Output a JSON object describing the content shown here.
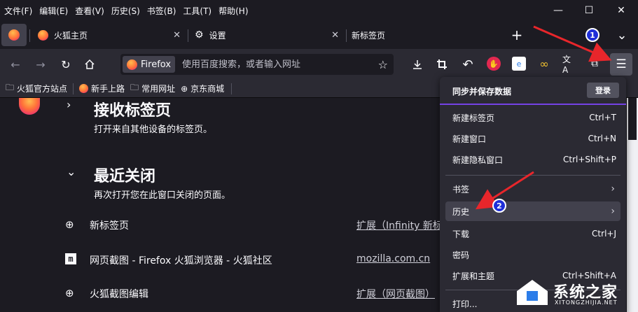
{
  "menubar": {
    "items": [
      "文件(F)",
      "编辑(E)",
      "查看(V)",
      "历史(S)",
      "书签(B)",
      "工具(T)",
      "帮助(H)"
    ]
  },
  "window_controls": {
    "minimize": "—",
    "maximize": "☐",
    "close": "✕"
  },
  "tabs": [
    {
      "label": "火狐主页",
      "icon": "firefox-icon"
    },
    {
      "label": "设置",
      "icon": "gear-icon"
    },
    {
      "label": "新标签页",
      "icon": ""
    }
  ],
  "tabstrip": {
    "new_tab": "+",
    "list_all": "⌄"
  },
  "urlbar": {
    "engine_label": "Firefox",
    "placeholder": "使用百度搜索，或者输入网址"
  },
  "bookmarks": [
    {
      "label": "火狐官方站点",
      "icon": "folder-icon"
    },
    {
      "label": "新手上路",
      "icon": "firefox-icon"
    },
    {
      "label": "常用网址",
      "icon": "folder-icon"
    },
    {
      "label": "京东商城",
      "icon": "globe-icon"
    }
  ],
  "content": {
    "synced_tabs": {
      "title": "接收标签页",
      "subtitle": "打开来自其他设备的标签页。"
    },
    "recently_closed": {
      "title": "最近关闭",
      "subtitle": "再次打开您在此窗口关闭的页面。",
      "rows": [
        {
          "icon": "globe-icon",
          "title": "新标签页",
          "url": "扩展（Infinity 新标"
        },
        {
          "icon": "mozilla-m-icon",
          "title": "网页截图 - Firefox 火狐浏览器 - 火狐社区",
          "url": "mozilla.com.cn"
        },
        {
          "icon": "globe-icon",
          "title": "火狐截图编辑",
          "url": "扩展（网页截图）"
        }
      ]
    }
  },
  "app_menu": {
    "header": "同步并保存数据",
    "signin": "登录",
    "items": [
      {
        "label": "新建标签页",
        "shortcut": "Ctrl+T"
      },
      {
        "label": "新建窗口",
        "shortcut": "Ctrl+N"
      },
      {
        "label": "新建隐私窗口",
        "shortcut": "Ctrl+Shift+P"
      },
      {
        "label": "书签",
        "shortcut": ""
      },
      {
        "label": "历史",
        "shortcut": ""
      },
      {
        "label": "下载",
        "shortcut": "Ctrl+J"
      },
      {
        "label": "密码",
        "shortcut": ""
      },
      {
        "label": "扩展和主题",
        "shortcut": "Ctrl+Shift+A"
      },
      {
        "label": "打印...",
        "shortcut": ""
      }
    ]
  },
  "annotations": {
    "badge_1": "1",
    "badge_2": "2",
    "arrow_color": "#e8262b"
  },
  "watermark": {
    "brand": "系统之家",
    "url": "XITONGZHIJIA.NET"
  },
  "colors": {
    "accent": "#7542e5",
    "toolbar": "#2b2a33",
    "background": "#1c1b22"
  }
}
